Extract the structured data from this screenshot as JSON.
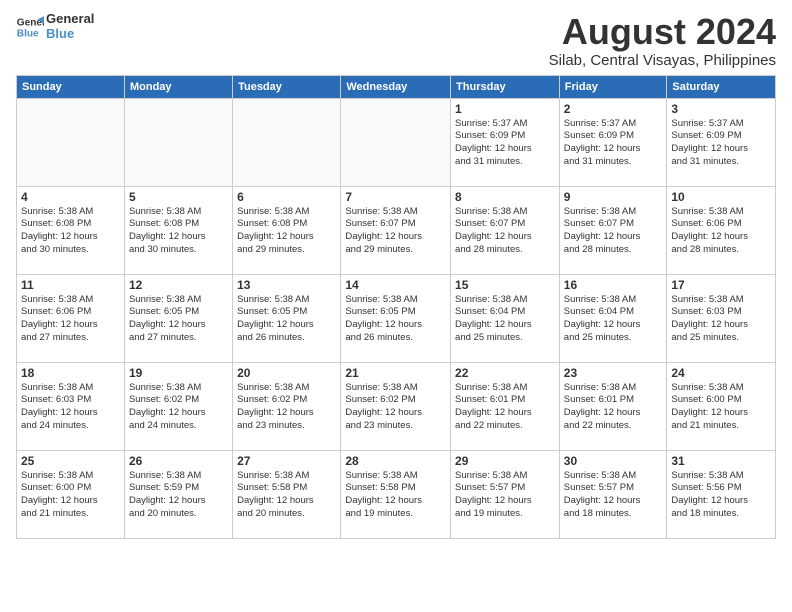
{
  "logo": {
    "line1": "General",
    "line2": "Blue"
  },
  "title": "August 2024",
  "subtitle": "Silab, Central Visayas, Philippines",
  "weekdays": [
    "Sunday",
    "Monday",
    "Tuesday",
    "Wednesday",
    "Thursday",
    "Friday",
    "Saturday"
  ],
  "weeks": [
    [
      {
        "day": "",
        "info": ""
      },
      {
        "day": "",
        "info": ""
      },
      {
        "day": "",
        "info": ""
      },
      {
        "day": "",
        "info": ""
      },
      {
        "day": "1",
        "info": "Sunrise: 5:37 AM\nSunset: 6:09 PM\nDaylight: 12 hours\nand 31 minutes."
      },
      {
        "day": "2",
        "info": "Sunrise: 5:37 AM\nSunset: 6:09 PM\nDaylight: 12 hours\nand 31 minutes."
      },
      {
        "day": "3",
        "info": "Sunrise: 5:37 AM\nSunset: 6:09 PM\nDaylight: 12 hours\nand 31 minutes."
      }
    ],
    [
      {
        "day": "4",
        "info": "Sunrise: 5:38 AM\nSunset: 6:08 PM\nDaylight: 12 hours\nand 30 minutes."
      },
      {
        "day": "5",
        "info": "Sunrise: 5:38 AM\nSunset: 6:08 PM\nDaylight: 12 hours\nand 30 minutes."
      },
      {
        "day": "6",
        "info": "Sunrise: 5:38 AM\nSunset: 6:08 PM\nDaylight: 12 hours\nand 29 minutes."
      },
      {
        "day": "7",
        "info": "Sunrise: 5:38 AM\nSunset: 6:07 PM\nDaylight: 12 hours\nand 29 minutes."
      },
      {
        "day": "8",
        "info": "Sunrise: 5:38 AM\nSunset: 6:07 PM\nDaylight: 12 hours\nand 28 minutes."
      },
      {
        "day": "9",
        "info": "Sunrise: 5:38 AM\nSunset: 6:07 PM\nDaylight: 12 hours\nand 28 minutes."
      },
      {
        "day": "10",
        "info": "Sunrise: 5:38 AM\nSunset: 6:06 PM\nDaylight: 12 hours\nand 28 minutes."
      }
    ],
    [
      {
        "day": "11",
        "info": "Sunrise: 5:38 AM\nSunset: 6:06 PM\nDaylight: 12 hours\nand 27 minutes."
      },
      {
        "day": "12",
        "info": "Sunrise: 5:38 AM\nSunset: 6:05 PM\nDaylight: 12 hours\nand 27 minutes."
      },
      {
        "day": "13",
        "info": "Sunrise: 5:38 AM\nSunset: 6:05 PM\nDaylight: 12 hours\nand 26 minutes."
      },
      {
        "day": "14",
        "info": "Sunrise: 5:38 AM\nSunset: 6:05 PM\nDaylight: 12 hours\nand 26 minutes."
      },
      {
        "day": "15",
        "info": "Sunrise: 5:38 AM\nSunset: 6:04 PM\nDaylight: 12 hours\nand 25 minutes."
      },
      {
        "day": "16",
        "info": "Sunrise: 5:38 AM\nSunset: 6:04 PM\nDaylight: 12 hours\nand 25 minutes."
      },
      {
        "day": "17",
        "info": "Sunrise: 5:38 AM\nSunset: 6:03 PM\nDaylight: 12 hours\nand 25 minutes."
      }
    ],
    [
      {
        "day": "18",
        "info": "Sunrise: 5:38 AM\nSunset: 6:03 PM\nDaylight: 12 hours\nand 24 minutes."
      },
      {
        "day": "19",
        "info": "Sunrise: 5:38 AM\nSunset: 6:02 PM\nDaylight: 12 hours\nand 24 minutes."
      },
      {
        "day": "20",
        "info": "Sunrise: 5:38 AM\nSunset: 6:02 PM\nDaylight: 12 hours\nand 23 minutes."
      },
      {
        "day": "21",
        "info": "Sunrise: 5:38 AM\nSunset: 6:02 PM\nDaylight: 12 hours\nand 23 minutes."
      },
      {
        "day": "22",
        "info": "Sunrise: 5:38 AM\nSunset: 6:01 PM\nDaylight: 12 hours\nand 22 minutes."
      },
      {
        "day": "23",
        "info": "Sunrise: 5:38 AM\nSunset: 6:01 PM\nDaylight: 12 hours\nand 22 minutes."
      },
      {
        "day": "24",
        "info": "Sunrise: 5:38 AM\nSunset: 6:00 PM\nDaylight: 12 hours\nand 21 minutes."
      }
    ],
    [
      {
        "day": "25",
        "info": "Sunrise: 5:38 AM\nSunset: 6:00 PM\nDaylight: 12 hours\nand 21 minutes."
      },
      {
        "day": "26",
        "info": "Sunrise: 5:38 AM\nSunset: 5:59 PM\nDaylight: 12 hours\nand 20 minutes."
      },
      {
        "day": "27",
        "info": "Sunrise: 5:38 AM\nSunset: 5:58 PM\nDaylight: 12 hours\nand 20 minutes."
      },
      {
        "day": "28",
        "info": "Sunrise: 5:38 AM\nSunset: 5:58 PM\nDaylight: 12 hours\nand 19 minutes."
      },
      {
        "day": "29",
        "info": "Sunrise: 5:38 AM\nSunset: 5:57 PM\nDaylight: 12 hours\nand 19 minutes."
      },
      {
        "day": "30",
        "info": "Sunrise: 5:38 AM\nSunset: 5:57 PM\nDaylight: 12 hours\nand 18 minutes."
      },
      {
        "day": "31",
        "info": "Sunrise: 5:38 AM\nSunset: 5:56 PM\nDaylight: 12 hours\nand 18 minutes."
      }
    ]
  ]
}
